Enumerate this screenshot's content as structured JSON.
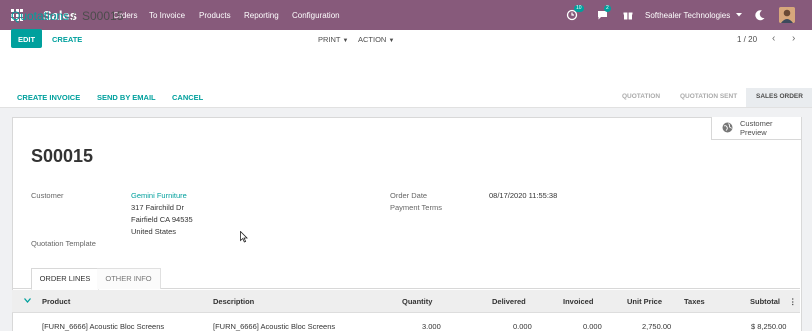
{
  "nav": {
    "app_name": "Sales",
    "menu": [
      "Orders",
      "To Invoice",
      "Products",
      "Reporting",
      "Configuration"
    ],
    "activity_count": "10",
    "message_count": "2",
    "company": "Softhealer Technologies"
  },
  "breadcrumb": {
    "parent": "Quotations",
    "separator": "/",
    "current": "S00015"
  },
  "toolbar": {
    "edit": "EDIT",
    "create": "CREATE",
    "print": "PRINT",
    "action": "ACTION"
  },
  "pager": {
    "value": "1 / 20"
  },
  "statusbar": {
    "buttons": [
      "CREATE INVOICE",
      "SEND BY EMAIL",
      "CANCEL"
    ],
    "stages": [
      "QUOTATION",
      "QUOTATION SENT",
      "SALES ORDER"
    ],
    "active_stage": "SALES ORDER"
  },
  "sheet": {
    "preview_line1": "Customer",
    "preview_line2": "Preview",
    "title": "S00015",
    "customer_label": "Customer",
    "customer_name": "Gemini Furniture",
    "customer_address": [
      "317 Fairchild Dr",
      "Fairfield CA 94535",
      "United States"
    ],
    "quotation_template_label": "Quotation Template",
    "order_date_label": "Order Date",
    "order_date_value": "08/17/2020 11:55:38",
    "payment_terms_label": "Payment Terms"
  },
  "tabs": [
    "ORDER LINES",
    "OTHER INFO"
  ],
  "table": {
    "columns": [
      "Product",
      "Description",
      "Quantity",
      "Delivered",
      "Invoiced",
      "Unit Price",
      "Taxes",
      "Subtotal"
    ],
    "rows": [
      {
        "product": "[FURN_6666] Acoustic Bloc Screens",
        "description": "[FURN_6666] Acoustic Bloc Screens",
        "quantity": "3.000",
        "delivered": "0.000",
        "invoiced": "0.000",
        "unit_price": "2,750.00",
        "taxes": "",
        "subtotal": "$ 8,250.00"
      }
    ]
  },
  "colors": {
    "navbar": "#875a7b",
    "accent": "#00a09d"
  }
}
